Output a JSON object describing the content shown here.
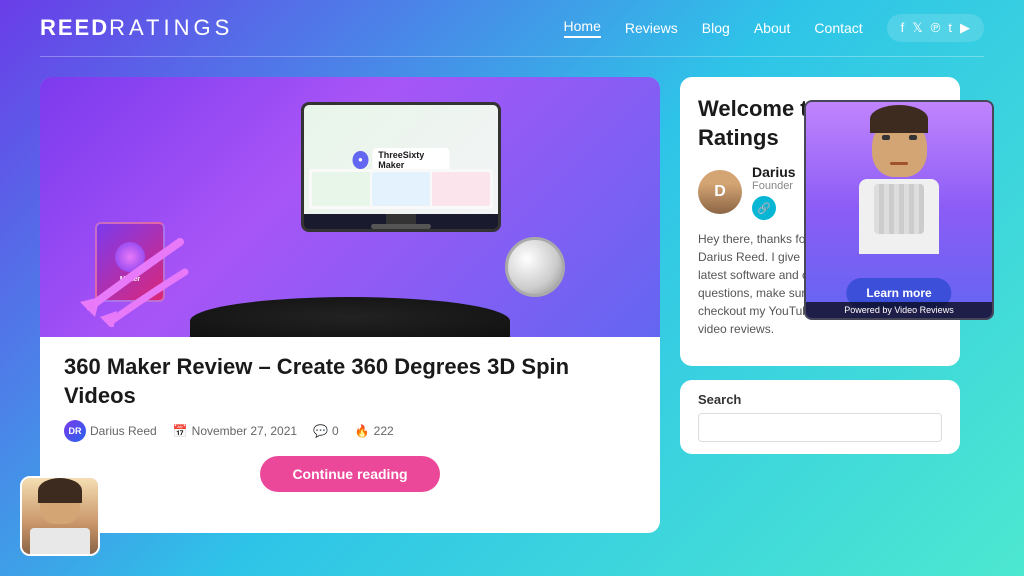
{
  "header": {
    "logo": "ReedRatings",
    "nav": {
      "items": [
        {
          "label": "Home",
          "active": true
        },
        {
          "label": "Reviews",
          "active": false
        },
        {
          "label": "Blog",
          "active": false
        },
        {
          "label": "About",
          "active": false
        },
        {
          "label": "Contact",
          "active": false
        }
      ]
    },
    "social": [
      "f",
      "t",
      "p",
      "t",
      "yt"
    ]
  },
  "article": {
    "title": "360 Maker Review – Create 360 Degrees 3D Spin Videos",
    "author": "Darius Reed",
    "date": "November 27, 2021",
    "comments": "0",
    "views": "222",
    "continue_btn": "Continue reading",
    "image_brand": "ThreeSixty Maker"
  },
  "sidebar": {
    "welcome_title": "Welcome to Reed Ratings",
    "author_name": "Darius",
    "author_role": "Founder",
    "bio_text": "Hey there, thanks for coming. My name is Darius Reed. I give honest reviews about the latest software and courses. If you have any questions, make sure you contact me or checkout my YouTube channel. I also do video reviews.",
    "search_label": "Search",
    "search_placeholder": ""
  },
  "video_popup": {
    "learn_more": "Learn more",
    "footer": "Powered by Video Reviews"
  }
}
